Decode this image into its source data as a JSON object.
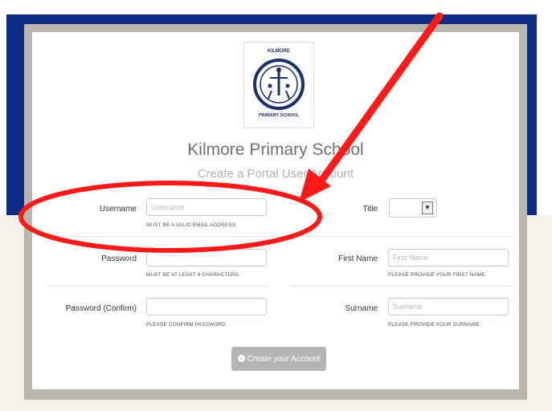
{
  "school": {
    "name": "Kilmore Primary School",
    "subtitle": "Create a Portal User Account",
    "logo_text_top": "KILMORE",
    "logo_text_bottom": "PRIMARY SCHOOL"
  },
  "form": {
    "username": {
      "label": "Username",
      "placeholder": "Username",
      "hint": "MUST BE A VALID EMAIL ADDRESS"
    },
    "password": {
      "label": "Password",
      "placeholder": "",
      "hint": "MUST BE AT LEAST 4 CHARACTERS"
    },
    "password_confirm": {
      "label": "Password (Confirm)",
      "placeholder": "",
      "hint": "PLEASE CONFIRM PASSWORD"
    },
    "title": {
      "label": "Title",
      "selected": ""
    },
    "first_name": {
      "label": "First Name",
      "placeholder": "First Name",
      "hint": "PLEASE PROVIDE YOUR FIRST NAME"
    },
    "surname": {
      "label": "Surname",
      "placeholder": "Surname",
      "hint": "PLEASE PROVIDE YOUR SURNAME"
    },
    "submit_label": "Create your Account"
  },
  "icons": {
    "select_arrow": "chevron-down-icon",
    "submit": "plus-circle-icon"
  },
  "colors": {
    "navy": "#0d2b82",
    "annotation_red": "#ff1a1a",
    "button": "#b4b4b4"
  }
}
